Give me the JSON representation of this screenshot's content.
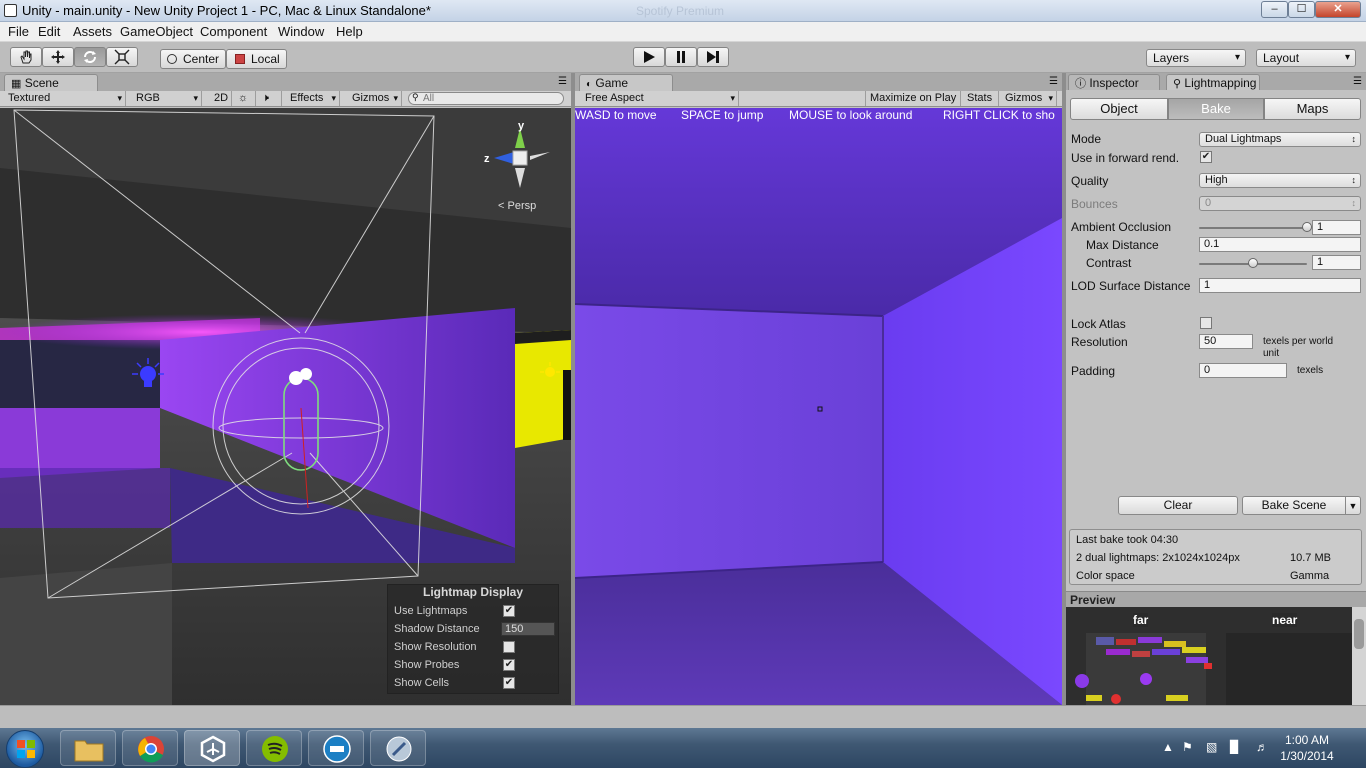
{
  "window": {
    "title": "Unity - main.unity - New Unity Project 1 - PC, Mac & Linux Standalone*",
    "ghost_title": "Spotify Premium",
    "min": "‒",
    "max": "☐",
    "close": "✕"
  },
  "menu": [
    "File",
    "Edit",
    "Assets",
    "GameObject",
    "Component",
    "Window",
    "Help"
  ],
  "toolbar": {
    "pivot": "Center",
    "space": "Local",
    "layers": "Layers",
    "layout": "Layout"
  },
  "scene": {
    "tab": "Scene",
    "strip": {
      "render": "Textured",
      "channel": "RGB",
      "two_d": "2D",
      "effects": "Effects",
      "gizmos": "Gizmos",
      "search_placeholder": "All"
    },
    "gizmo": {
      "y": "y",
      "z": "z",
      "persp": "Persp"
    },
    "lightmap_display": {
      "header": "Lightmap Display",
      "use_lightmaps": "Use Lightmaps",
      "use_lightmaps_checked": true,
      "shadow_distance": "Shadow Distance",
      "shadow_distance_value": "150",
      "show_resolution": "Show Resolution",
      "show_resolution_checked": false,
      "show_probes": "Show Probes",
      "show_probes_checked": true,
      "show_cells": "Show Cells",
      "show_cells_checked": true
    }
  },
  "game": {
    "tab": "Game",
    "aspect": "Free Aspect",
    "maximize": "Maximize on Play",
    "stats": "Stats",
    "gizmos": "Gizmos",
    "hud": [
      "WASD to move",
      "SPACE to jump",
      "MOUSE to look around",
      "RIGHT CLICK to sho"
    ]
  },
  "inspector": {
    "tabs": [
      "Inspector",
      "Lightmapping"
    ],
    "segments": [
      "Object",
      "Bake",
      "Maps"
    ],
    "active_segment": "Bake",
    "mode_label": "Mode",
    "mode_value": "Dual Lightmaps",
    "forward_label": "Use in forward rend.",
    "forward_checked": true,
    "quality_label": "Quality",
    "quality_value": "High",
    "bounces_label": "Bounces",
    "bounces_value": "0",
    "ao_label": "Ambient Occlusion",
    "ao_value": "1",
    "ao_fraction": 1.0,
    "maxdist_label": "Max Distance",
    "maxdist_value": "0.1",
    "contrast_label": "Contrast",
    "contrast_value": "1",
    "contrast_fraction": 0.5,
    "lod_label": "LOD Surface Distance",
    "lod_value": "1",
    "lock_label": "Lock Atlas",
    "lock_checked": false,
    "res_label": "Resolution",
    "res_value": "50",
    "res_unit_1": "texels per world",
    "res_unit_2": "unit",
    "pad_label": "Padding",
    "pad_value": "0",
    "pad_unit": "texels",
    "clear": "Clear",
    "bake": "Bake Scene",
    "info": {
      "last_bake": "Last bake took 04:30",
      "lightmaps": "2 dual lightmaps: 2x1024x1024px",
      "size": "10.7 MB",
      "cs_label": "Color space",
      "cs_value": "Gamma"
    },
    "preview": {
      "title": "Preview",
      "far": "far",
      "near": "near"
    }
  },
  "taskbar": {
    "time": "1:00 AM",
    "date": "1/30/2014"
  },
  "colors": {
    "accent_purple": "#6a3cf0",
    "yellow_light": "#ffe800",
    "panel": "#c2c2c2"
  }
}
